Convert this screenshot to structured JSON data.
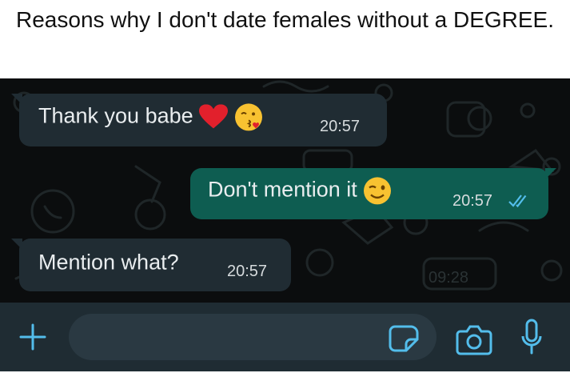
{
  "post": {
    "caption": "Reasons why I don't date females without a DEGREE."
  },
  "chat": {
    "messages": [
      {
        "direction": "incoming",
        "text": "Thank you babe",
        "emoji": [
          "red-heart",
          "face-blowing-kiss"
        ],
        "time": "20:57"
      },
      {
        "direction": "outgoing",
        "text": "Don't mention it",
        "emoji": [
          "winking-face"
        ],
        "time": "20:57",
        "status": "read-double-check"
      },
      {
        "direction": "incoming",
        "text": "Mention what?",
        "emoji": [],
        "time": "20:57"
      }
    ],
    "wallpaper_clock": "09:28"
  },
  "input_bar": {
    "message_placeholder": "",
    "icons": [
      "plus-icon",
      "sticker-icon",
      "camera-icon",
      "microphone-icon"
    ]
  },
  "colors": {
    "chat_background": "#0b0d0e",
    "incoming_bubble": "#202c33",
    "outgoing_bubble": "#0e5d51",
    "accent": "#53bdeb",
    "input_bar": "#1f2c33",
    "field": "#2a3942"
  }
}
